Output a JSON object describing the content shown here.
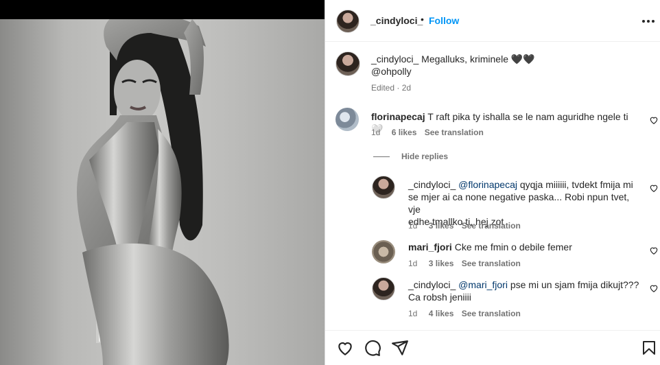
{
  "post": {
    "author": "_cindyloci_",
    "follow_label": "Follow",
    "dot": "•",
    "caption_text": "Megalluks, kriminele 🖤🖤",
    "caption_mention": "@ohpolly",
    "caption_meta": "Edited · 2d"
  },
  "comments": [
    {
      "user": "florinapecaj",
      "text": "T raft pika ty ishalla se le nam aguridhe ngele ti 🤍",
      "time": "1d",
      "likes": "6 likes",
      "translate": "See translation"
    }
  ],
  "hide_replies_label": "Hide replies",
  "replies": [
    {
      "user": "_cindyloci_",
      "mention": "@florinapecaj",
      "text_line1": "qyqja miiiiii, tvdekt fmija mi",
      "text_line2": "se mjer ai ca none negative paska... Robi npun tvet, vje",
      "text_line3": "edhe tmallko ti, hej zot",
      "time": "1d",
      "likes": "3 likes",
      "translate": "See translation"
    },
    {
      "user": "mari_fjori",
      "text": "Cke me fmin o debile femer",
      "time": "1d",
      "likes": "3 likes",
      "translate": "See translation"
    },
    {
      "user": "_cindyloci_",
      "mention": "@mari_fjori",
      "text_line1": "pse mi un sjam fmija dikujt???",
      "text_line2": "Ca robsh jeniiii",
      "time": "1d",
      "likes": "4 likes",
      "translate": "See translation"
    }
  ],
  "icons": {
    "more": "more-options-icon",
    "like": "heart-icon",
    "comment": "comment-icon",
    "share": "share-icon",
    "save": "bookmark-icon"
  }
}
